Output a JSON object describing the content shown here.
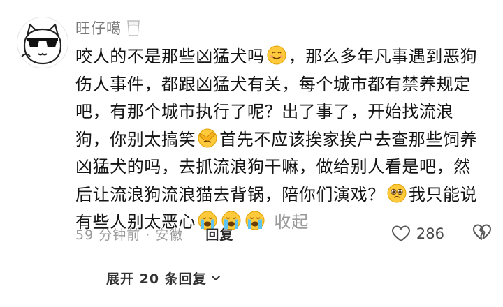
{
  "user": {
    "name": "旺仔噶",
    "badge_icon": "milk-glass-icon",
    "avatar_icon": "cool-cat-sunglasses-avatar"
  },
  "comment": {
    "seg1": "咬人的不是那些凶猛犬吗",
    "emoji1": "smiling-emoji",
    "seg2": "，那么多年凡事遇到恶狗伤人事件，都跟凶猛犬有关，每个城市都有禁养规定吧，有那个城市执行了呢？出了事了，开始找流浪狗，你别太搞笑",
    "emoji2": "facepalm-emoji",
    "seg3": "首先不应该挨家挨户去查那些饲养凶猛犬的吗，去抓流浪狗干嘛，做给别人看是吧，然后让流浪狗流浪猫去背锅，陪你们演戏？",
    "emoji3": "pleading-emoji",
    "seg4": "我只能说有些人别太恶心",
    "emoji4": "loudly-crying-emoji",
    "collapse_label": "收起"
  },
  "meta": {
    "time_location": "59 分钟前 · 安徽",
    "reply_label": "回复",
    "like_count": "286",
    "like_icon": "heart-outline-icon",
    "dislike_icon": "broken-heart-icon"
  },
  "replies": {
    "expand_label": "展开 20 条回复",
    "expand_icon": "chevron-down-icon"
  },
  "colors": {
    "text_primary": "#141414",
    "text_secondary": "#9a9a9a",
    "emoji_yellow": "#FFC93C"
  }
}
